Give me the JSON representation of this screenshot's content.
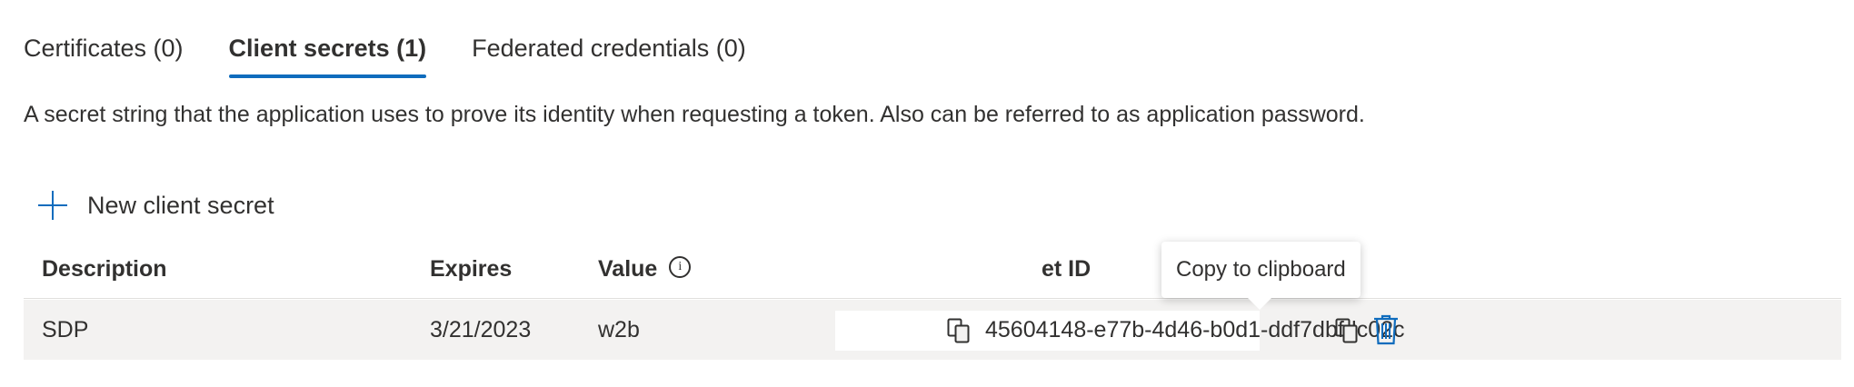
{
  "tabs": [
    {
      "label": "Certificates (0)",
      "active": false
    },
    {
      "label": "Client secrets (1)",
      "active": true
    },
    {
      "label": "Federated credentials (0)",
      "active": false
    }
  ],
  "description": "A secret string that the application uses to prove its identity when requesting a token. Also can be referred to as application password.",
  "toolbar": {
    "new_secret_label": "New client secret",
    "icon": "plus-icon"
  },
  "table": {
    "headers": {
      "description": "Description",
      "expires": "Expires",
      "value": "Value",
      "secret_id": "et ID"
    },
    "rows": [
      {
        "description": "SDP",
        "expires": "3/21/2023",
        "value": "w2b",
        "secret_id": "45604148-e77b-4d46-b0d1-ddf7dbfdc02c"
      }
    ]
  },
  "tooltip": {
    "text": "Copy to clipboard"
  },
  "icons": {
    "info": "info-icon",
    "copy": "copy-icon",
    "delete": "trash-icon"
  },
  "colors": {
    "accent": "#0f6cbd",
    "row_background": "#f3f2f1",
    "text": "#323130"
  }
}
